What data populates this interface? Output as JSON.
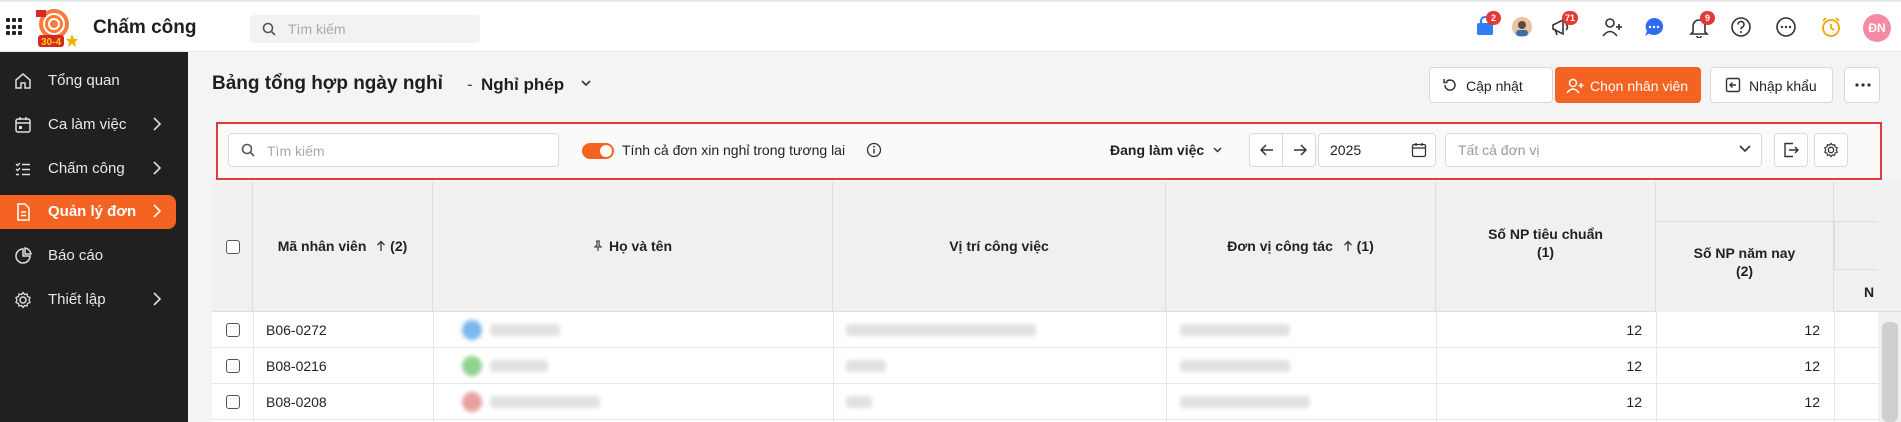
{
  "app": {
    "title": "Chấm công",
    "search_placeholder": "Tìm kiếm",
    "logo_text": "30-4",
    "badges": {
      "cart": "2",
      "announce": "71",
      "bell": "9"
    },
    "user_initials": "ĐN"
  },
  "sidebar": {
    "items": [
      {
        "label": "Tổng quan",
        "icon": "home-icon",
        "has_chevron": false
      },
      {
        "label": "Ca làm việc",
        "icon": "calendar-icon",
        "has_chevron": true
      },
      {
        "label": "Chấm công",
        "icon": "checklist-icon",
        "has_chevron": true
      },
      {
        "label": "Quản lý đơn",
        "icon": "document-icon",
        "has_chevron": true,
        "active": true
      },
      {
        "label": "Báo cáo",
        "icon": "pie-chart-icon",
        "has_chevron": false
      },
      {
        "label": "Thiết lập",
        "icon": "gear-icon",
        "has_chevron": true
      }
    ]
  },
  "header": {
    "title": "Bảng tổng hợp ngày nghỉ",
    "separator": "-",
    "subtitle": "Nghỉ phép",
    "buttons": {
      "refresh": "Cập nhật",
      "choose_employee": "Chọn nhân viên",
      "import": "Nhập khẩu"
    }
  },
  "filters": {
    "search_placeholder": "Tìm kiếm",
    "toggle_label": "Tính cả đơn xin nghỉ trong tương lai",
    "toggle_on": true,
    "status": "Đang làm việc",
    "year": "2025",
    "unit_placeholder": "Tất cả đơn vị"
  },
  "table": {
    "columns": {
      "code": "Mã nhân viên",
      "code_sort": "(2)",
      "name": "Họ và tên",
      "position": "Vị trí công việc",
      "unit": "Đơn vị công tác",
      "unit_sort": "(1)",
      "np_standard": "Số NP tiêu chuẩn",
      "np_standard_sub": "(1)",
      "np_this_year": "Số NP năm nay",
      "np_this_year_sub": "(2)",
      "next_col": "N"
    },
    "rows": [
      {
        "code": "B06-0272",
        "np_standard": "12",
        "np_this_year": "12"
      },
      {
        "code": "B08-0216",
        "np_standard": "12",
        "np_this_year": "12"
      },
      {
        "code": "B08-0208",
        "np_standard": "12",
        "np_this_year": "12"
      }
    ]
  },
  "colors": {
    "accent": "#f46321",
    "sidebar_bg": "#202020",
    "highlight_border": "#e23b3b"
  }
}
